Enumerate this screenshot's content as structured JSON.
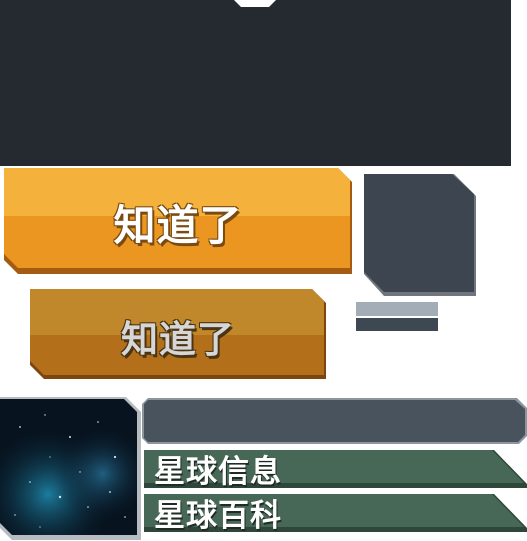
{
  "buttons": {
    "confirm_primary": "知道了",
    "confirm_secondary": "知道了"
  },
  "tabs": [
    {
      "label": "星球信息"
    },
    {
      "label": "星球百科"
    }
  ],
  "colors": {
    "panel_dark": "#252a31",
    "orange_top": "#f4b13b",
    "orange_bottom": "#ec9622",
    "orange_dim_top": "#c1872b",
    "orange_dim_bottom": "#b46f1a",
    "tile_dark": "#3d4650",
    "bar_light": "#a3adb7",
    "bar_dark": "#3d4853",
    "wide_bar": "#48535d",
    "tab_green": "#476757"
  },
  "icons": {
    "planet": "planet-starfield-image"
  }
}
